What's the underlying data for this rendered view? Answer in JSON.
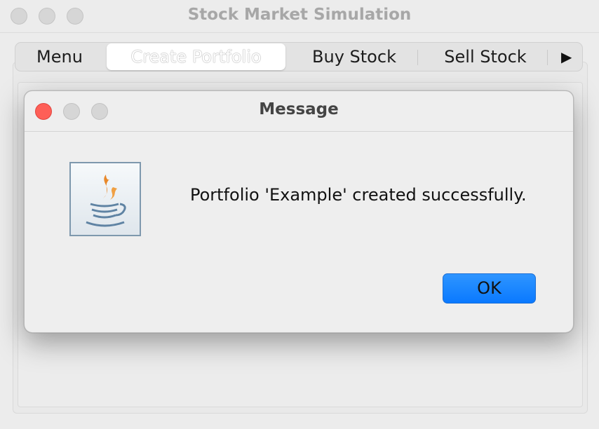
{
  "window": {
    "title": "Stock Market Simulation"
  },
  "tabs": [
    {
      "label": "Menu",
      "selected": false
    },
    {
      "label": "Create Portfolio",
      "selected": true
    },
    {
      "label": "Buy Stock",
      "selected": false
    },
    {
      "label": "Sell Stock",
      "selected": false
    }
  ],
  "tab_overflow_arrow": "▶",
  "dialog": {
    "title": "Message",
    "icon": "java-coffee-cup-icon",
    "message": "Portfolio 'Example' created successfully.",
    "ok_label": "OK"
  },
  "colors": {
    "close_button": "#fe5f57",
    "ok_button": "#0a79ff"
  }
}
